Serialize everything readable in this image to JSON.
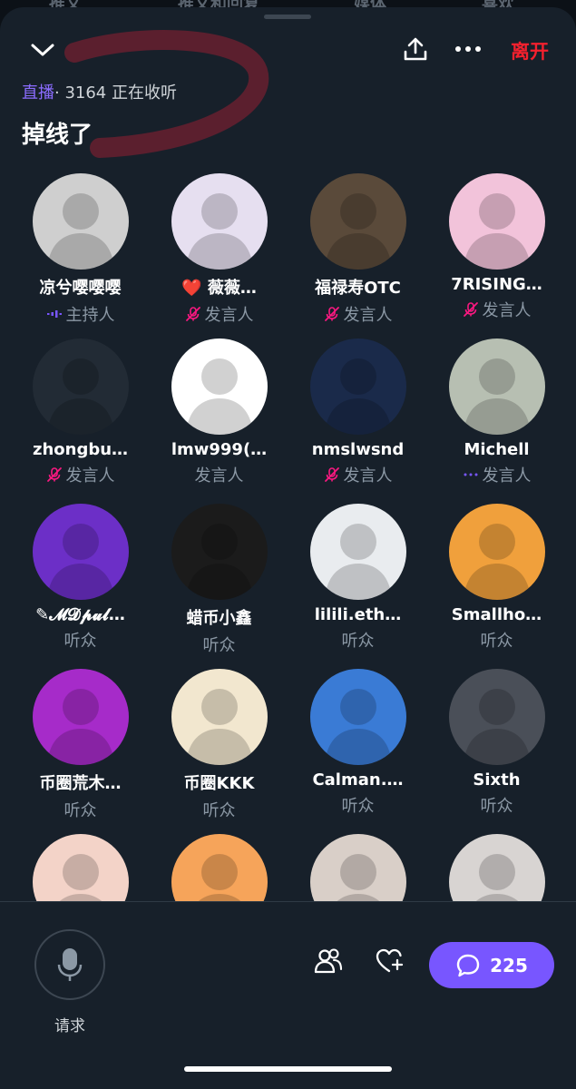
{
  "background_tabs": [
    "推文",
    "推文和回复",
    "媒体",
    "喜欢"
  ],
  "header": {
    "leave_label": "离开",
    "live_label": "直播",
    "listening_text": "· 3164 正在收听",
    "title": "掉线了"
  },
  "participants": [
    {
      "name": "凉兮嘤嘤嘤",
      "role": "主持人",
      "status": "speaking",
      "avatar_color": "#cfcfcf"
    },
    {
      "name": "❤️ 薇薇…",
      "role": "发言人",
      "status": "muted",
      "avatar_color": "#e6dff0"
    },
    {
      "name": "福禄寿OTC",
      "role": "发言人",
      "status": "muted",
      "avatar_color": "#5a4a3a"
    },
    {
      "name": "7RISING…",
      "role": "发言人",
      "status": "muted",
      "avatar_color": "#f2c3da"
    },
    {
      "name": "zhongbu…",
      "role": "发言人",
      "status": "muted",
      "avatar_color": "#222b35"
    },
    {
      "name": "lmw999(…",
      "role": "发言人",
      "status": "none",
      "avatar_color": "#ffffff"
    },
    {
      "name": "nmslwsnd",
      "role": "发言人",
      "status": "muted",
      "avatar_color": "#1a2a4a"
    },
    {
      "name": "Michell",
      "role": "发言人",
      "status": "idle",
      "avatar_color": "#b7bfb2"
    },
    {
      "name": "✎𝓜𝓓𝓹𝓾𝓵…",
      "role": "听众",
      "status": "none",
      "avatar_color": "#6c2fc7"
    },
    {
      "name": "蜡币小鑫",
      "role": "听众",
      "status": "none",
      "avatar_color": "#1b1b1b"
    },
    {
      "name": "lilili.eth…",
      "role": "听众",
      "status": "none",
      "avatar_color": "#e9ecef"
    },
    {
      "name": "Smallho…",
      "role": "听众",
      "status": "none",
      "avatar_color": "#f0a03c"
    },
    {
      "name": "币圈荒木…",
      "role": "听众",
      "status": "none",
      "avatar_color": "#a62bc9"
    },
    {
      "name": "币圈KKK",
      "role": "听众",
      "status": "none",
      "avatar_color": "#f2e7cf"
    },
    {
      "name": "Calman.…",
      "role": "听众",
      "status": "none",
      "avatar_color": "#3a7bd5"
    },
    {
      "name": "Sixth",
      "role": "听众",
      "status": "none",
      "avatar_color": "#4a4f58"
    },
    {
      "name": "",
      "role": "",
      "status": "none",
      "avatar_color": "#f3d3c8"
    },
    {
      "name": "",
      "role": "",
      "status": "none",
      "avatar_color": "#f6a45a"
    },
    {
      "name": "",
      "role": "",
      "status": "none",
      "avatar_color": "#d9cfc8"
    },
    {
      "name": "",
      "role": "",
      "status": "none",
      "avatar_color": "#d8d4d2"
    }
  ],
  "bottom": {
    "request_label": "请求",
    "comments_count": "225"
  },
  "colors": {
    "accent": "#7856ff",
    "leave": "#f4212e",
    "muted": "#f91880",
    "sheet": "#17202a"
  }
}
